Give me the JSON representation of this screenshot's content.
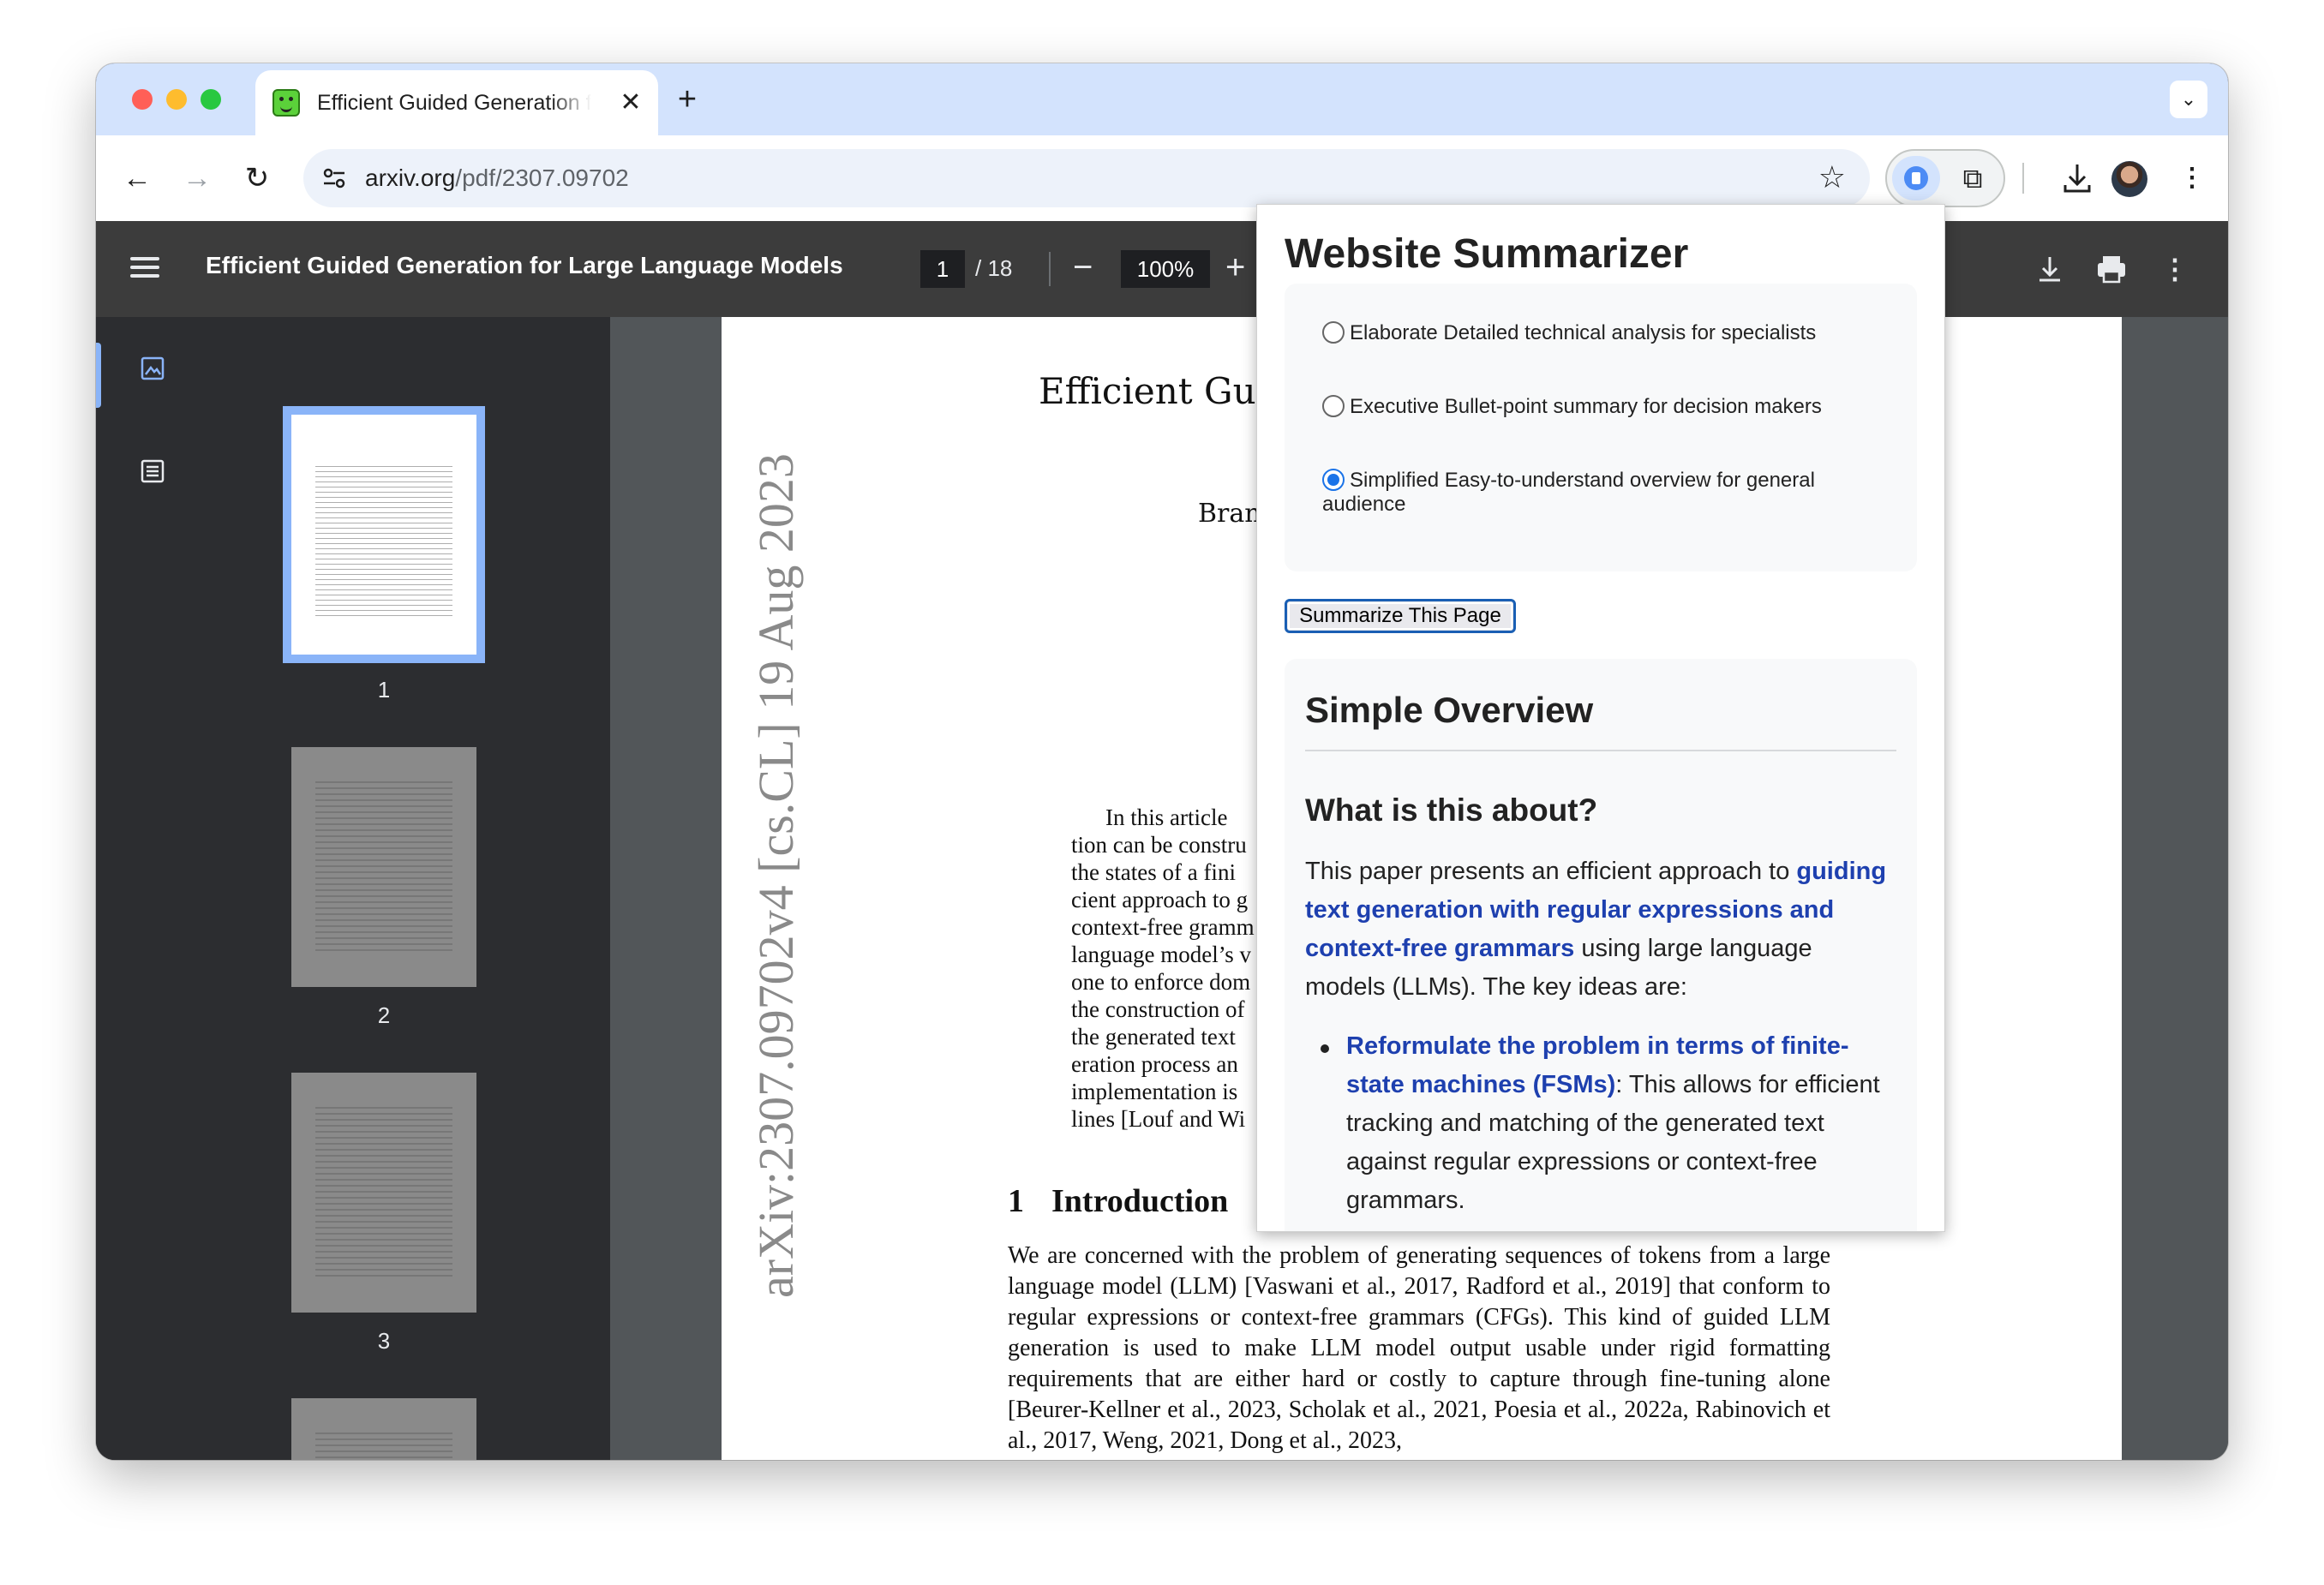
{
  "browser": {
    "tab": {
      "title": "Efficient Guided Generation for Large Language Models",
      "close": "✕"
    },
    "new_tab": "+",
    "tab_menu": "⌄",
    "url": {
      "domain": "arxiv.org",
      "path": "/pdf/2307.09702"
    },
    "icons": [
      "back-arrow-icon",
      "forward-arrow-icon",
      "reload-icon",
      "site-settings-icon",
      "bookmark-star-icon",
      "extension-summarizer-icon",
      "extensions-puzzle-icon",
      "download-icon",
      "avatar",
      "more-vert-icon"
    ]
  },
  "pdf_toolbar": {
    "title": "Efficient Guided Generation for Large Language Models",
    "page_current": "1",
    "page_total": "/ 18",
    "zoom": "100%"
  },
  "thumbnails": [
    {
      "label": "1"
    },
    {
      "label": "2"
    },
    {
      "label": "3"
    }
  ],
  "pdf_page": {
    "title_visible": "Efficient Guid",
    "author_visible": "Bran",
    "arxiv_stamp": "arXiv:2307.09702v4  [cs.CL]  19 Aug 2023",
    "abstract_lines": [
      "In this article",
      "tion can be constru",
      "the states of a fini",
      "cient approach to g",
      "context-free gramm",
      "language model’s v",
      "one to enforce dom",
      "the construction of",
      "the generated text",
      "eration process an",
      "implementation is",
      "lines [Louf and Wi"
    ],
    "section_number": "1",
    "section_title": "Introduction",
    "body": "We are concerned with the problem of generating sequences of tokens from a large language model (LLM) [Vaswani et al., 2017, Radford et al., 2019] that conform to regular expressions or context-free grammars (CFGs). This kind of guided LLM generation is used to make LLM model output usable under rigid formatting requirements that are either hard or costly to capture through fine-tuning alone [Beurer-Kellner et al., 2023, Scholak et al., 2021, Poesia et al., 2022a, Rabinovich et al., 2017, Weng, 2021, Dong et al., 2023,"
  },
  "popup": {
    "title": "Website Summarizer",
    "options": [
      {
        "label": "Elaborate Detailed technical analysis for specialists",
        "selected": false
      },
      {
        "label": "Executive Bullet-point summary for decision makers",
        "selected": false
      },
      {
        "label": "Simplified Easy-to-understand overview for general audience",
        "selected": true
      }
    ],
    "button": "Summarize This Page",
    "result": {
      "heading": "Simple Overview",
      "subheading": "What is this about?",
      "para_start": "This paper presents an efficient approach to ",
      "para_highlight": "guiding text generation with regular expressions and context-free grammars",
      "para_end": " using large language models (LLMs). The key ideas are:",
      "bullet_highlight": "Reformulate the problem in terms of finite-state machines (FSMs)",
      "bullet_rest": ": This allows for efficient tracking and matching of the generated text against regular expressions or context-free grammars."
    },
    "accent_color": "#1a73e8",
    "highlight_color": "#1e40af"
  }
}
